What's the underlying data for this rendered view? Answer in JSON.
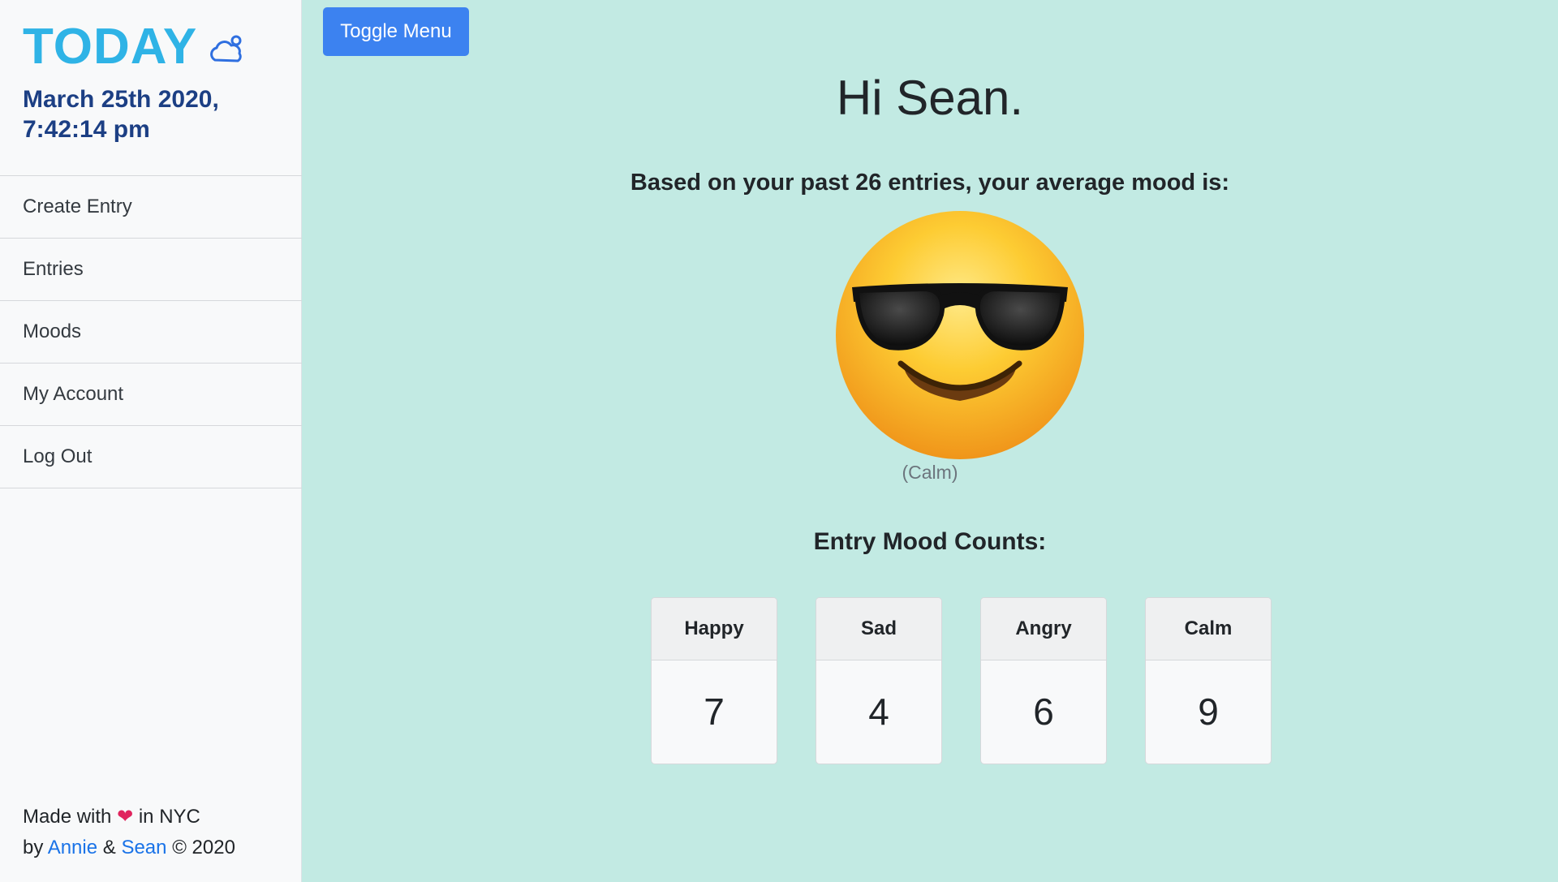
{
  "sidebar": {
    "brand": "TODAY",
    "brand_icon": "cloud-icon",
    "datetime": "March 25th 2020, 7:42:14 pm",
    "nav": [
      {
        "label": "Create Entry"
      },
      {
        "label": "Entries"
      },
      {
        "label": "Moods"
      },
      {
        "label": "My Account"
      },
      {
        "label": "Log Out"
      }
    ],
    "footer": {
      "line1_pre": "Made with",
      "heart": "❤",
      "line1_post": "in NYC",
      "by": "by",
      "author1": "Annie",
      "amp": "&",
      "author2": "Sean",
      "copyright": "© 2020"
    }
  },
  "toolbar": {
    "toggle_label": "Toggle Menu"
  },
  "main": {
    "greeting": "Hi Sean.",
    "summary": "Based on your past 26 entries, your average mood is:",
    "average_mood_icon": "sunglasses-face-emoji",
    "average_mood_label": "(Calm)",
    "counts_title": "Entry Mood Counts:",
    "counts": [
      {
        "label": "Happy",
        "value": "7"
      },
      {
        "label": "Sad",
        "value": "4"
      },
      {
        "label": "Angry",
        "value": "6"
      },
      {
        "label": "Calm",
        "value": "9"
      }
    ]
  },
  "colors": {
    "background": "#c2eae3",
    "brand": "#2fb3e6",
    "datetime": "#1c3f84",
    "button": "#3c82f0",
    "link": "#1a73e8"
  }
}
